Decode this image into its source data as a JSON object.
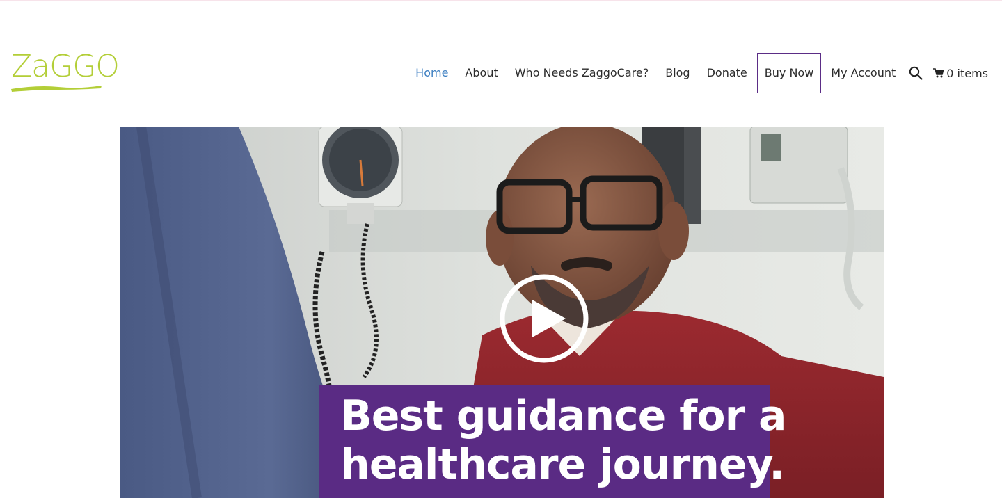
{
  "brand": {
    "logo_text": "ZaGGO",
    "logo_color": "#b3ce37"
  },
  "nav": {
    "items": [
      {
        "label": "Home",
        "active": true
      },
      {
        "label": "About"
      },
      {
        "label": "Who Needs ZaggoCare?"
      },
      {
        "label": "Blog"
      },
      {
        "label": "Donate"
      },
      {
        "label": "Buy Now",
        "boxed": true
      },
      {
        "label": "My Account"
      }
    ],
    "search_icon": "search-icon",
    "cart_icon": "cart-icon",
    "cart_label": "0 items",
    "active_color": "#3d7fc1",
    "boxed_border_color": "#5b2d86"
  },
  "hero": {
    "play_icon": "play-icon",
    "caption_line1": "Best guidance for a",
    "caption_line2": "healthcare journey.",
    "caption_bg": "#5a2b84"
  }
}
